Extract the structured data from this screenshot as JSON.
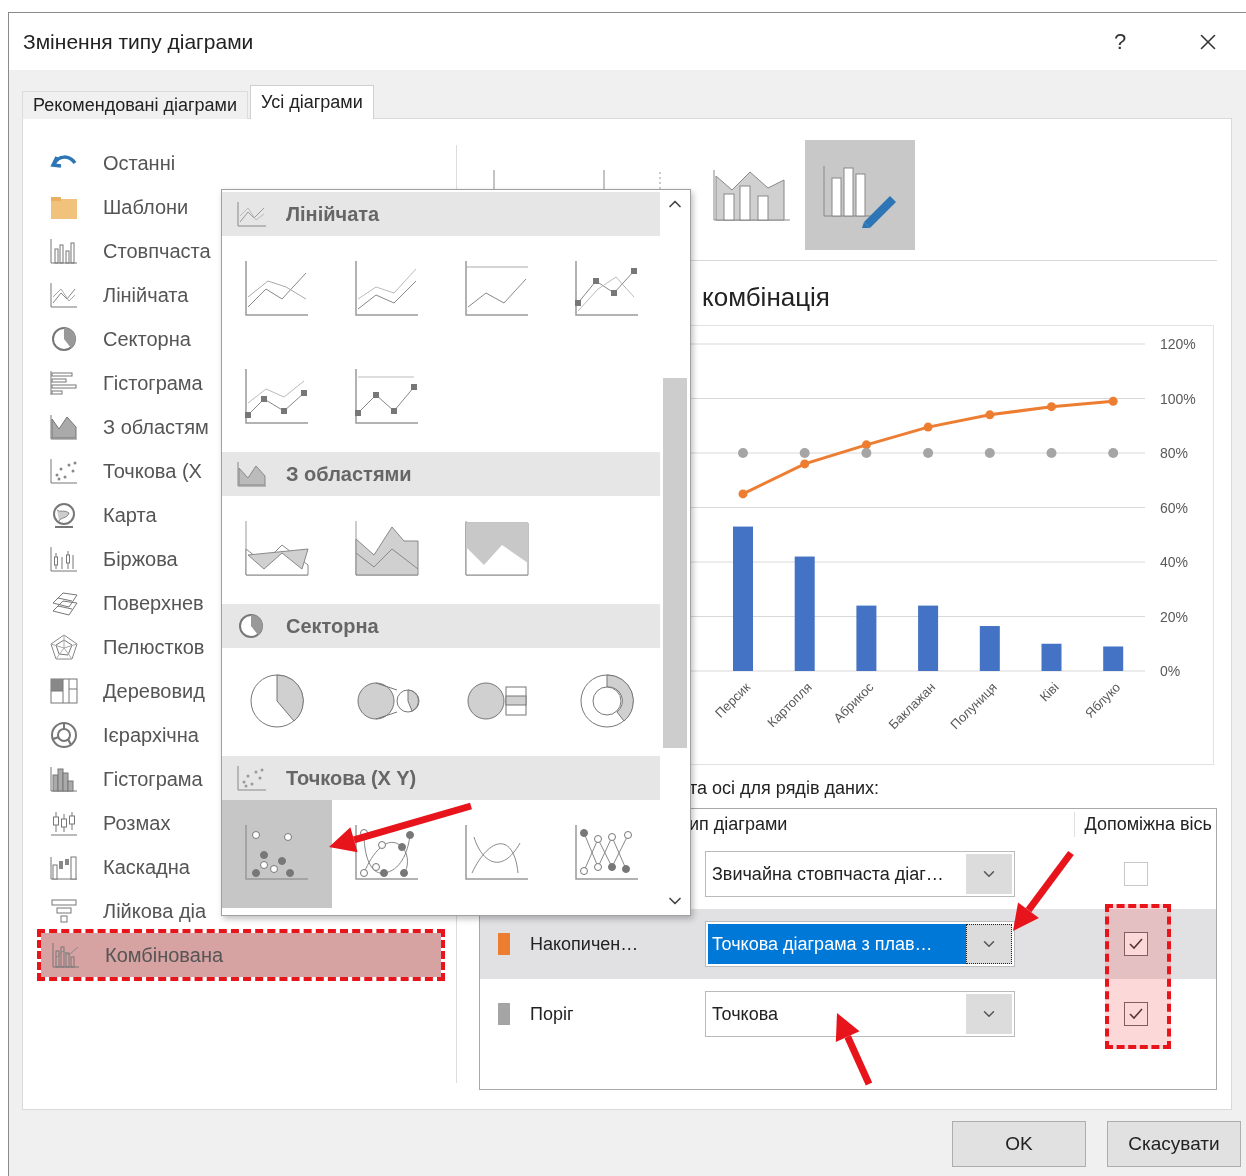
{
  "window": {
    "title": "Змінення типу діаграми",
    "help": "?"
  },
  "tabs": [
    {
      "label": "Рекомендовані діаграми",
      "selected": false
    },
    {
      "label": "Усі діаграми",
      "selected": true
    }
  ],
  "chart_types": [
    {
      "label": "Останні",
      "selected": false
    },
    {
      "label": "Шаблони",
      "selected": false
    },
    {
      "label": "Стовпчаста",
      "selected": false
    },
    {
      "label": "Лінійчата",
      "selected": false
    },
    {
      "label": "Секторна",
      "selected": false
    },
    {
      "label": "Гістограма",
      "selected": false
    },
    {
      "label": "З областям",
      "selected": false
    },
    {
      "label": "Точкова (X",
      "selected": false
    },
    {
      "label": "Карта",
      "selected": false
    },
    {
      "label": "Біржова",
      "selected": false
    },
    {
      "label": "Поверхнев",
      "selected": false
    },
    {
      "label": "Пелюстков",
      "selected": false
    },
    {
      "label": "Деревовид",
      "selected": false
    },
    {
      "label": "Ієрархічна",
      "selected": false
    },
    {
      "label": "Гістограма",
      "selected": false
    },
    {
      "label": "Розмах",
      "selected": false
    },
    {
      "label": "Каскадна",
      "selected": false
    },
    {
      "label": "Лійкова діа",
      "selected": false
    },
    {
      "label": "Комбінована",
      "selected": true
    }
  ],
  "type_popup": {
    "sections": [
      {
        "kind": "line",
        "title": "Лінійчата",
        "thumbnails": [
          {
            "selected": false
          },
          {
            "selected": false
          },
          {
            "selected": false
          },
          {
            "selected": false
          },
          {
            "selected": false
          },
          {
            "selected": false
          }
        ]
      },
      {
        "kind": "area",
        "title": "З областями",
        "thumbnails": [
          {
            "selected": false
          },
          {
            "selected": false
          },
          {
            "selected": false
          }
        ]
      },
      {
        "kind": "pie",
        "title": "Секторна",
        "thumbnails": [
          {
            "selected": false
          },
          {
            "selected": false
          },
          {
            "selected": false
          },
          {
            "selected": false
          }
        ]
      },
      {
        "kind": "scatter",
        "title": "Точкова (X Y)",
        "thumbnails": [
          {
            "selected": true
          },
          {
            "selected": false
          },
          {
            "selected": false
          },
          {
            "selected": false
          }
        ]
      }
    ]
  },
  "variants": [
    {
      "selected": false
    },
    {
      "selected": false
    },
    {
      "selected": false
    },
    {
      "selected": true
    }
  ],
  "heading": "комбінація",
  "chart": {
    "chart_data": {
      "type": "bar",
      "categories": [
        "Персик",
        "Картопля",
        "Абрикос",
        "Баклажан",
        "Полуниця",
        "Ківі",
        "Яблуко"
      ],
      "series": [
        {
          "type": "bar",
          "color": "#4472c4",
          "values": [
            53,
            42,
            24,
            24,
            16.5,
            10,
            9
          ]
        },
        {
          "type": "line",
          "marker": true,
          "color": "#ed7d31",
          "values": [
            65,
            76,
            83,
            89.5,
            94,
            97,
            99
          ]
        },
        {
          "type": "scatter",
          "color": "#a5a5a5",
          "values": [
            80,
            80,
            80,
            80,
            80,
            80,
            80
          ]
        }
      ],
      "ylim": [
        0,
        120
      ],
      "grid": true,
      "yticks": [
        {
          "value": 0,
          "label": "0%"
        },
        {
          "value": 20,
          "label": "20%"
        },
        {
          "value": 40,
          "label": "40%"
        },
        {
          "value": 60,
          "label": "60%"
        },
        {
          "value": 80,
          "label": "80%"
        },
        {
          "value": 100,
          "label": "100%"
        },
        {
          "value": 120,
          "label": "120%"
        }
      ]
    }
  },
  "series_label": "та осі для рядів даних:",
  "series_table": {
    "columns": [
      "ип діаграми",
      "Допоміжна вісь"
    ],
    "rows": [
      {
        "chart_type": "Звичайна стовпчаста діаг…",
        "secondary_axis": false,
        "selected": false
      },
      {
        "name": "Накопичен…",
        "color": "#ed7d31",
        "chart_type": "Точкова діаграма з плав…",
        "secondary_axis": true,
        "selected": true
      },
      {
        "name": "Поріг",
        "color": "#a5a5a5",
        "chart_type": "Точкова",
        "secondary_axis": true,
        "selected": false
      }
    ]
  },
  "buttons": [
    "OK",
    "Скасувати"
  ]
}
